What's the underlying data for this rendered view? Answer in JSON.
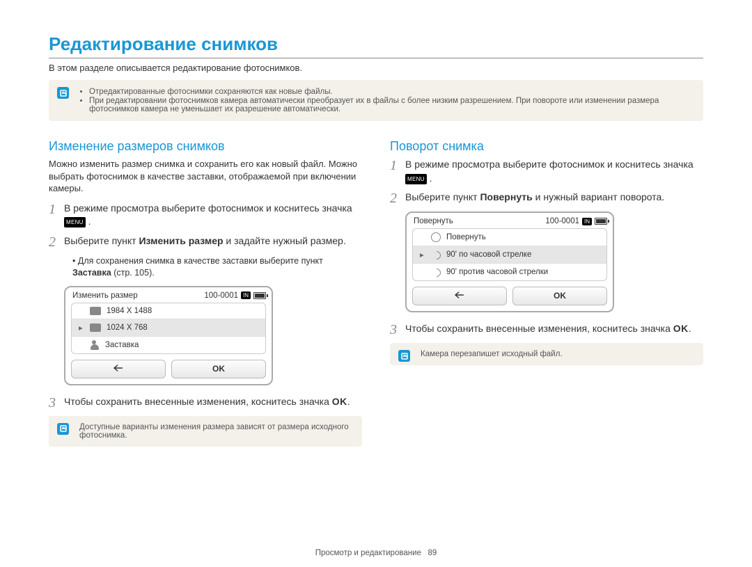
{
  "title": "Редактирование снимков",
  "intro": "В этом разделе описывается редактирование фотоснимков.",
  "top_note": {
    "items": [
      "Отредактированные фотоснимки сохраняются как новые файлы.",
      "При редактировании фотоснимков камера автоматически преобразует их в файлы с более низким разрешением. При повороте или изменении размера фотоснимков камера не уменьшает их разрешение автоматически."
    ]
  },
  "menu_badge_label": "MENU",
  "ok_label": "OK",
  "icon_labels": {
    "in": "IN"
  },
  "left": {
    "heading": "Изменение размеров снимков",
    "intro": "Можно изменить размер снимка и сохранить его как новый файл. Можно выбрать фотоснимок в качестве заставки, отображаемой при включении камеры.",
    "steps": [
      {
        "num": "1",
        "pre": "В режиме просмотра выберите фотоснимок и коснитесь значка ",
        "after": "."
      },
      {
        "num": "2",
        "pre": "Выберите пункт ",
        "bold": "Изменить размер",
        "post": " и задайте нужный размер."
      }
    ],
    "sub_bullet_pre": "Для сохранения снимка в качестве заставки выберите пункт ",
    "sub_bullet_bold": "Заставка",
    "sub_bullet_post": " (стр. 105).",
    "step3_pre": "Чтобы сохранить внесенные изменения, коснитесь значка ",
    "step3_num": "3",
    "device": {
      "title": "Изменить размер",
      "file_no": "100-0001",
      "rows": [
        {
          "label": "1984 X 1488"
        },
        {
          "label": "1024 X 768",
          "selected": true
        },
        {
          "label": "Заставка",
          "person": true
        }
      ],
      "ok": "OK"
    },
    "bottom_note": "Доступные варианты изменения размера зависят от размера исходного фотоснимка."
  },
  "right": {
    "heading": "Поворот снимка",
    "steps": [
      {
        "num": "1",
        "pre": "В режиме просмотра выберите фотоснимок и коснитесь значка ",
        "after": "."
      },
      {
        "num": "2",
        "pre": "Выберите пункт ",
        "bold": "Повернуть",
        "post": " и нужный вариант поворота."
      }
    ],
    "device": {
      "title": "Повернуть",
      "file_no": "100-0001",
      "rows": [
        {
          "label": "Повернуть",
          "rotate": true
        },
        {
          "label": "90' по часовой стрелке",
          "selected": true,
          "arrow": true
        },
        {
          "label": "90' против часовой стрелки",
          "arrow": true
        }
      ],
      "ok": "OK"
    },
    "step3_pre": "Чтобы сохранить внесенные изменения, коснитесь значка ",
    "step3_num": "3",
    "bottom_note": "Камера перезапишет исходный файл."
  },
  "footer": {
    "section": "Просмотр и редактирование",
    "page": "89"
  }
}
